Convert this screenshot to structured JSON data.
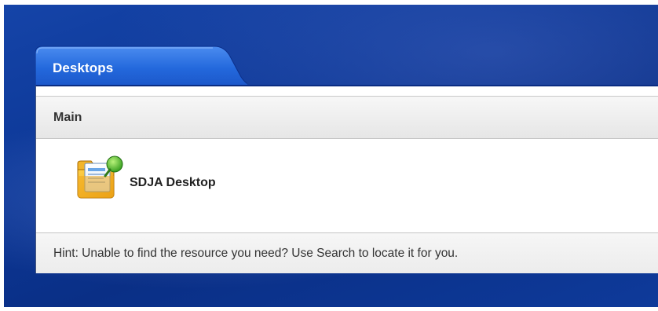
{
  "tab": {
    "label": "Desktops"
  },
  "section": {
    "title": "Main"
  },
  "resources": [
    {
      "label": "SDJA Desktop",
      "icon": "desktop-folder-shortcut-icon"
    }
  ],
  "hint": {
    "text": "Hint: Unable to find the resource you need? Use Search to locate it for you."
  },
  "colors": {
    "background_blue": "#0c3796",
    "tab_blue": "#1d63d6",
    "panel_border": "#0a2c82"
  }
}
